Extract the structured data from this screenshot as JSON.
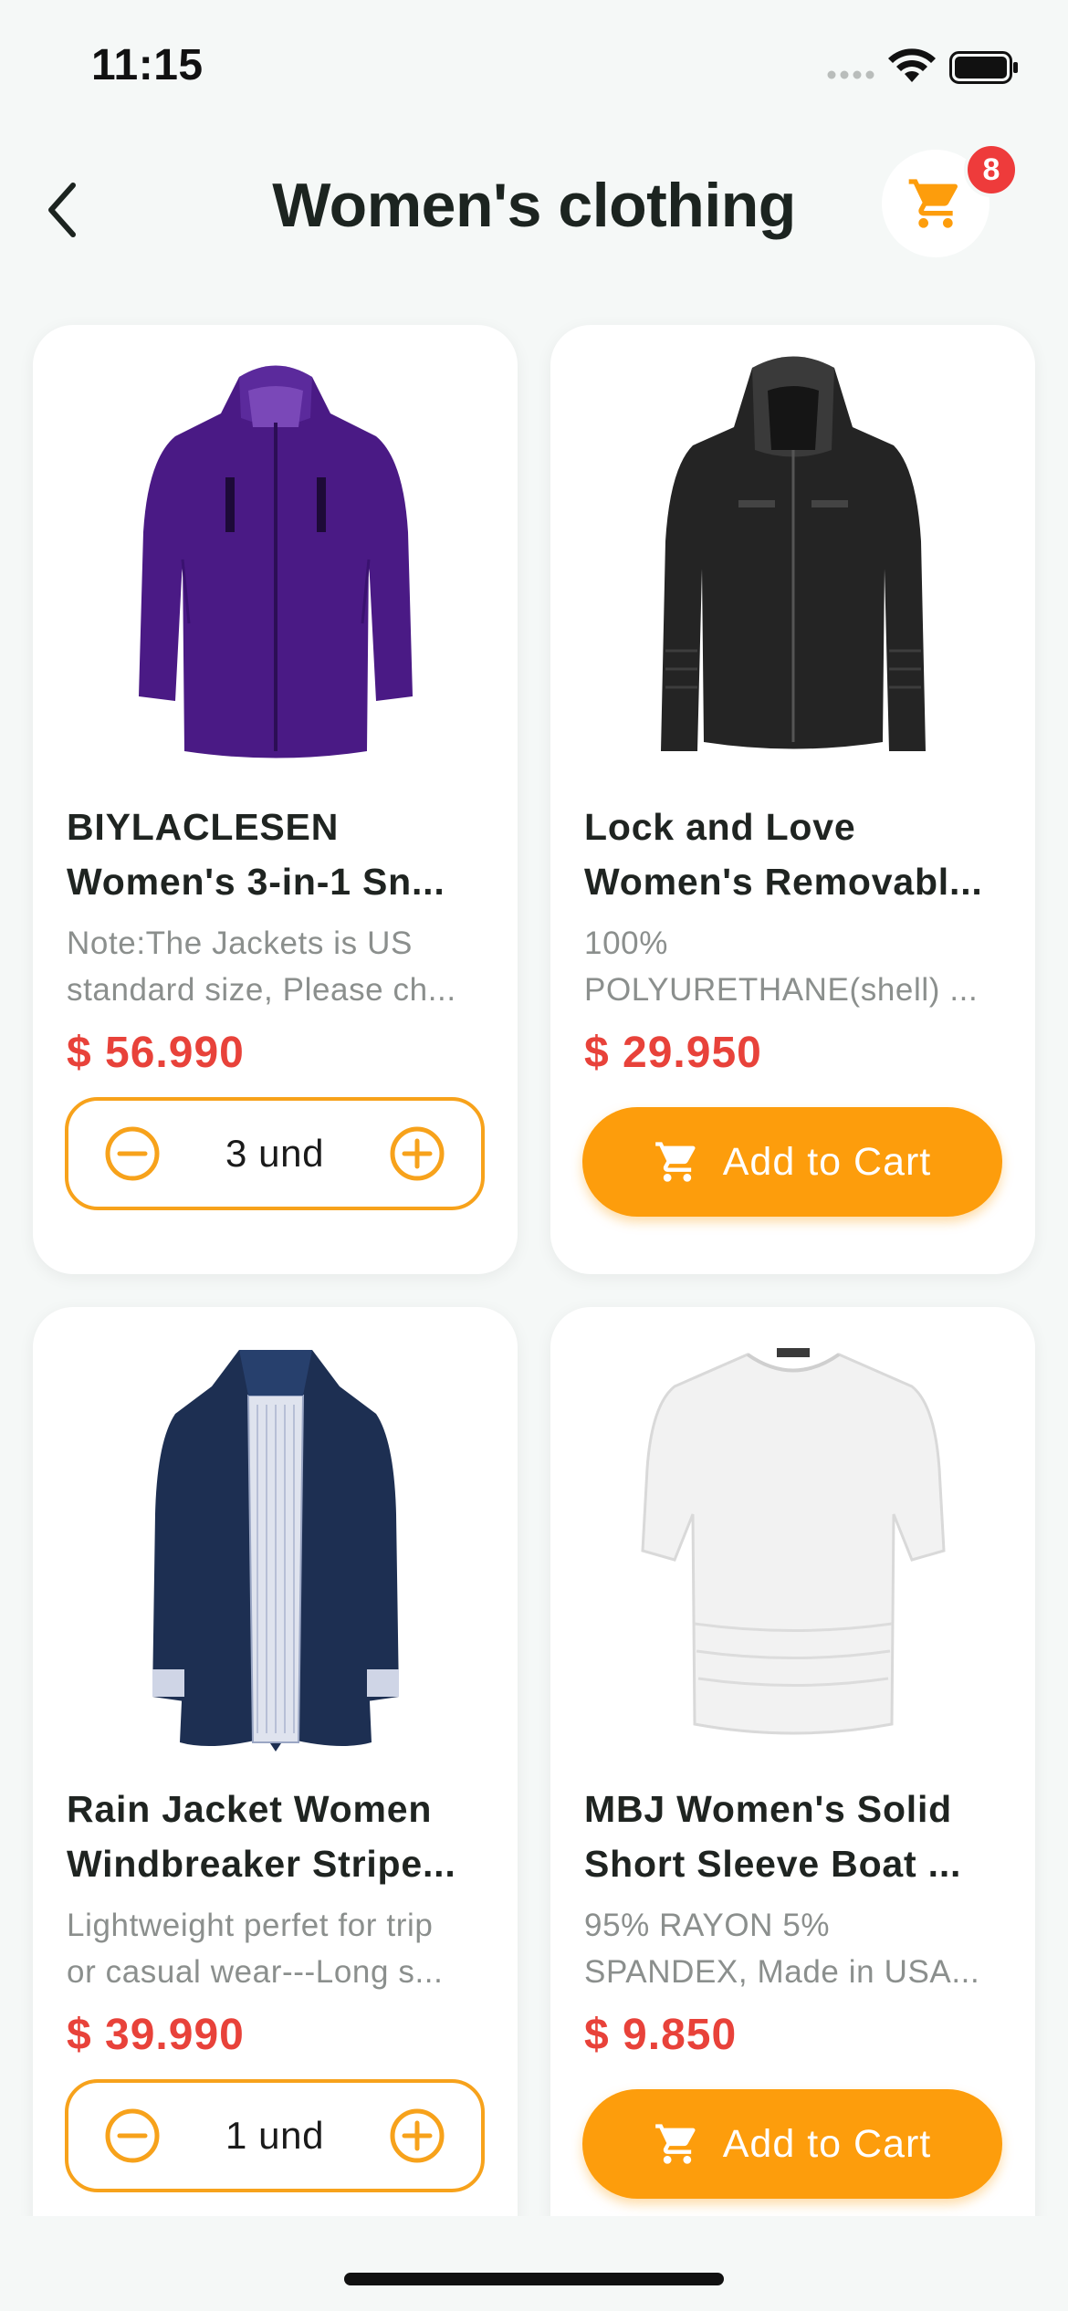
{
  "status_bar": {
    "time": "11:15"
  },
  "header": {
    "title": "Women's clothing",
    "cart_count": "8"
  },
  "colors": {
    "accent": "#fd9d0c",
    "price": "#e8423a",
    "badge": "#ee3b3b",
    "background": "#f5f8f7"
  },
  "products": [
    {
      "title_line1": "BIYLACLESEN",
      "title_line2": "Women's 3-in-1 Sn...",
      "desc_line1": "Note:The Jackets is US",
      "desc_line2": "standard size, Please ch...",
      "price": "$ 56.990",
      "image": "purple-jacket",
      "in_cart": true,
      "quantity": "3 und"
    },
    {
      "title_line1": "Lock and Love",
      "title_line2": "Women's Removabl...",
      "desc_line1": "100%",
      "desc_line2": "POLYURETHANE(shell) ...",
      "price": "$ 29.950",
      "image": "black-leather-jacket",
      "in_cart": false,
      "add_label": "Add to Cart"
    },
    {
      "title_line1": "Rain Jacket Women",
      "title_line2": "Windbreaker Stripe...",
      "desc_line1": "Lightweight perfet for trip",
      "desc_line2": "or casual wear---Long s...",
      "price": "$ 39.990",
      "image": "navy-rain-jacket",
      "in_cart": true,
      "quantity": "1 und"
    },
    {
      "title_line1": "MBJ Women's Solid",
      "title_line2": "Short Sleeve Boat ...",
      "desc_line1": "95% RAYON 5%",
      "desc_line2": "SPANDEX, Made in USA...",
      "price": "$ 9.850",
      "image": "white-top",
      "in_cart": false,
      "add_label": "Add to Cart"
    }
  ]
}
